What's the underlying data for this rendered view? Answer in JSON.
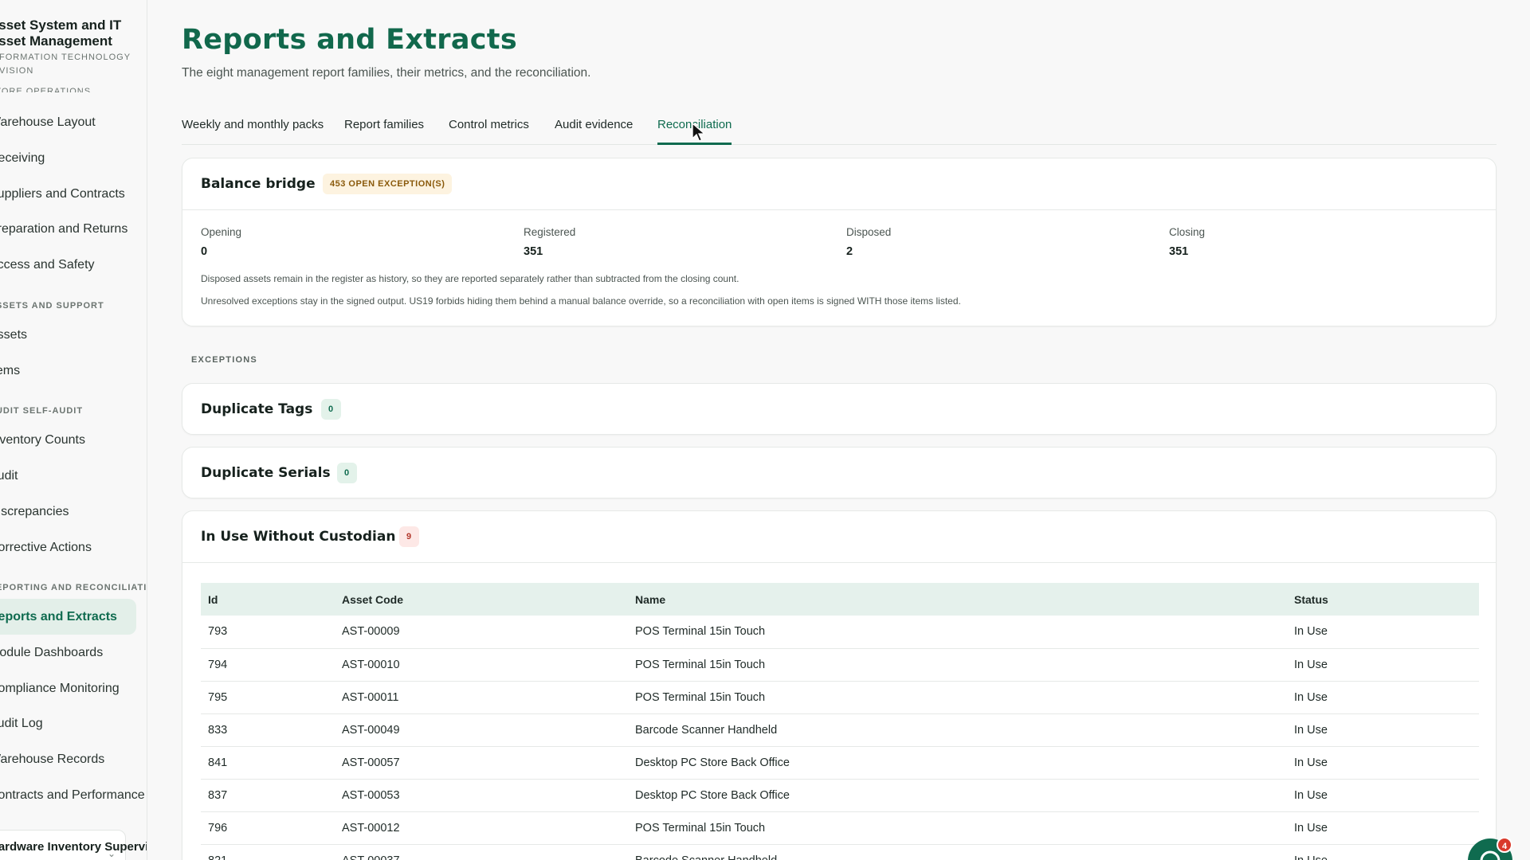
{
  "sidebar": {
    "title": "Asset System and IT Asset Management",
    "subtitle": "INFORMATION TECHNOLOGY DIVISION",
    "cut_section": "STORE OPERATIONS",
    "items_top": [
      "Warehouse Layout",
      "Receiving",
      "Suppliers and Contracts",
      "Preparation and Returns",
      "Access and Safety"
    ],
    "section_support": "ASSETS AND SUPPORT",
    "items_support": [
      "Assets",
      "Items"
    ],
    "section_audit": "AUDIT SELF-AUDIT",
    "items_audit": [
      "Inventory Counts",
      "Audit",
      "Discrepancies",
      "Corrective Actions"
    ],
    "section_reports": "REPORTING AND RECONCILIATION",
    "items_reports": [
      "Reports and Extracts",
      "Module Dashboards",
      "Compliance Monitoring",
      "Audit Log",
      "Warehouse Records",
      "Contracts and Performance"
    ],
    "user_name": "Hardware Inventory Supervisor"
  },
  "page": {
    "title": "Reports and Extracts",
    "subtitle": "The eight management report families, their metrics, and the reconciliation."
  },
  "tabs": [
    "Weekly and monthly packs",
    "Report families",
    "Control metrics",
    "Audit evidence",
    "Reconciliation"
  ],
  "active_tab": "Reconciliation",
  "balance_bridge": {
    "title": "Balance bridge",
    "badge": "453 OPEN EXCEPTION(S)",
    "metrics": [
      {
        "label": "Opening",
        "value": "0"
      },
      {
        "label": "Registered",
        "value": "351"
      },
      {
        "label": "Disposed",
        "value": "2"
      },
      {
        "label": "Closing",
        "value": "351"
      }
    ],
    "note1": "Disposed assets remain in the register as history, so they are reported separately rather than subtracted from the closing count.",
    "note2": "Unresolved exceptions stay in the signed output. US19 forbids hiding them behind a manual balance override, so a reconciliation with open items is signed WITH those items listed."
  },
  "exceptions_label": "EXCEPTIONS",
  "exceptions": {
    "duplicate_tags": {
      "title": "Duplicate Tags",
      "count": "0"
    },
    "duplicate_serials": {
      "title": "Duplicate Serials",
      "count": "0"
    },
    "in_use_without_custodian": {
      "title": "In Use Without Custodian",
      "count": "9",
      "columns": [
        "Id",
        "Asset Code",
        "Name",
        "Status"
      ],
      "rows": [
        [
          "793",
          "AST-00009",
          "POS Terminal 15in Touch",
          "In Use"
        ],
        [
          "794",
          "AST-00010",
          "POS Terminal 15in Touch",
          "In Use"
        ],
        [
          "795",
          "AST-00011",
          "POS Terminal 15in Touch",
          "In Use"
        ],
        [
          "833",
          "AST-00049",
          "Barcode Scanner Handheld",
          "In Use"
        ],
        [
          "841",
          "AST-00057",
          "Desktop PC Store Back Office",
          "In Use"
        ],
        [
          "837",
          "AST-00053",
          "Desktop PC Store Back Office",
          "In Use"
        ],
        [
          "796",
          "AST-00012",
          "POS Terminal 15in Touch",
          "In Use"
        ],
        [
          "821",
          "AST-00037",
          "Barcode Scanner Handheld",
          "In Use"
        ]
      ]
    }
  },
  "help_badge": "4",
  "colors": {
    "accent": "#0f6b4f",
    "warn": "#8a5a0b",
    "danger": "#b2372b"
  }
}
